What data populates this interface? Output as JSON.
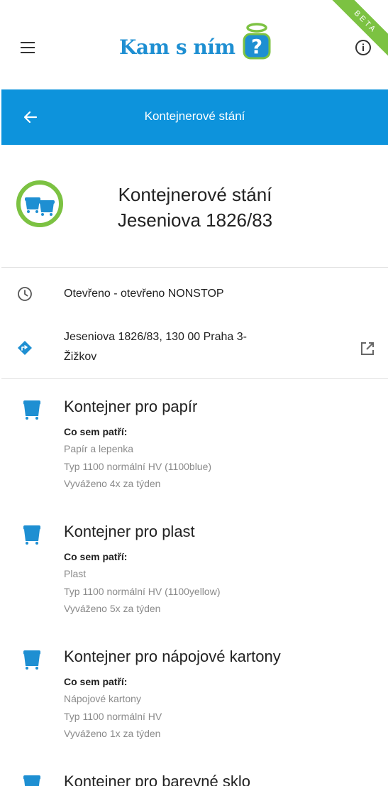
{
  "header": {
    "logo_text": "Kam s ním",
    "beta_label": "BETA"
  },
  "title_bar": {
    "title": "Kontejnerové stání"
  },
  "station": {
    "name_line1": "Kontejnerové stání",
    "name_line2": "Jeseniova 1826/83"
  },
  "info": {
    "hours": "Otevřeno - otevřeno NONSTOP",
    "address_line1": "Jeseniova 1826/83, 130 00 Praha 3-",
    "address_line2": "Žižkov"
  },
  "colors": {
    "primary_blue": "#0d93dc",
    "logo_green": "#7cc242",
    "container_blue": "#1e8fd2"
  },
  "containers": [
    {
      "title": "Kontejner pro papír",
      "label": "Co sem patří:",
      "lines": [
        "Papír a lepenka",
        "Typ 1100 normální HV (1100blue)",
        "Vyváženo 4x za týden"
      ]
    },
    {
      "title": "Kontejner pro plast",
      "label": "Co sem patří:",
      "lines": [
        "Plast",
        "Typ 1100 normální HV (1100yellow)",
        "Vyváženo 5x za týden"
      ]
    },
    {
      "title": "Kontejner pro nápojové kartony",
      "label": "Co sem patří:",
      "lines": [
        "Nápojové kartony",
        "Typ 1100 normální HV",
        "Vyváženo 1x za týden"
      ]
    },
    {
      "title": "Kontejner pro barevné sklo",
      "label": "",
      "lines": []
    }
  ]
}
